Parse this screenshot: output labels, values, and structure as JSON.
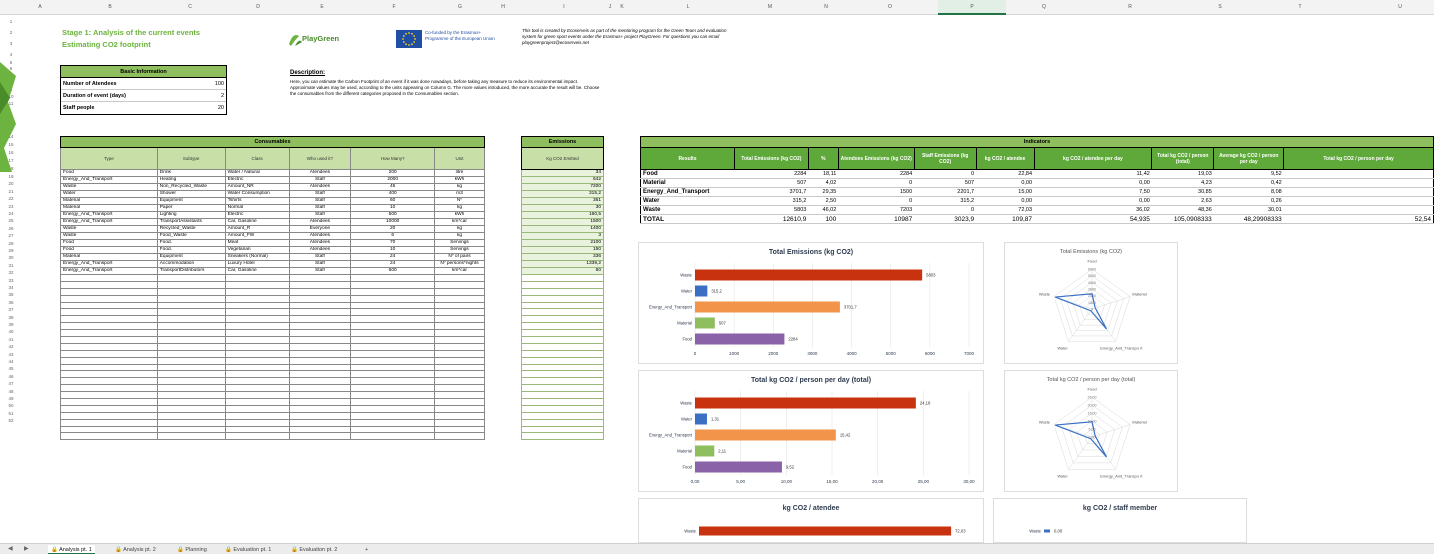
{
  "columns": [
    "A",
    "B",
    "C",
    "D",
    "E",
    "F",
    "G",
    "H",
    "I",
    "J",
    "K",
    "L",
    "M",
    "N",
    "O",
    "P",
    "Q",
    "R",
    "S",
    "T",
    "U"
  ],
  "rows": [
    "1",
    "2",
    "3",
    "4",
    "5",
    "6",
    "7",
    "8",
    "9",
    "10",
    "11",
    "12",
    "13",
    "14",
    "15",
    "16",
    "17",
    "18",
    "19",
    "20",
    "21",
    "22",
    "23",
    "24",
    "25",
    "26",
    "27",
    "28",
    "29",
    "30",
    "31",
    "32",
    "33",
    "34",
    "35",
    "36",
    "37",
    "38",
    "39",
    "40",
    "41",
    "42",
    "43",
    "44",
    "45",
    "46",
    "47",
    "48",
    "49",
    "50",
    "51",
    "52"
  ],
  "header": {
    "title_line1": "Stage 1: Analysis of the current events",
    "title_line2": "Estimating CO2 footprint",
    "playgreen": "PlayGreen",
    "eu_text": "Co-funded by the Erasmus+ Programme of the European Union",
    "note": "This tool is created by Ecoserveis as part of the mentoring program for the Green Team and evaluation system for green sport events under the Erasmus+ project PlayGreen. For questions you can email playgreenproject@ecoserveis.net"
  },
  "description": {
    "heading": "Description:",
    "text": "Here, you can estimate the Carbon Footprint of an event if it was done nowadays, before taking any measure to reduce its environmental impact. Approximate values may be used, according to the units appearing on Column G. The more values introduced, the more accurate the result will be. Choose the consumables from the different categories proposed in the Consumables section."
  },
  "basic_info": {
    "title": "Basic Information",
    "rows": [
      {
        "label": "Number of Atendees",
        "value": "100"
      },
      {
        "label": "Duration of event (days)",
        "value": "2"
      },
      {
        "label": "Staff people",
        "value": "20"
      }
    ]
  },
  "consumables": {
    "title": "Consumables",
    "headers": [
      "Type",
      "Subtype",
      "Class",
      "Who used it?",
      "How Many?",
      "Unit"
    ],
    "rows": [
      [
        "Food",
        "Drink",
        "Water / Natural",
        "Atendees",
        "200",
        "litre"
      ],
      [
        "Energy_And_Transport",
        "Heating",
        "Electric",
        "Staff",
        "2000",
        "kWh"
      ],
      [
        "Waste",
        "Non_Recycled_Waste",
        "Amount_NR",
        "Atendees",
        "45",
        "kg"
      ],
      [
        "Water",
        "Shower",
        "Water Consumption",
        "Staff",
        "400",
        "m3"
      ],
      [
        "Material",
        "Equipment",
        "Tshirts",
        "Staff",
        "60",
        "Nº"
      ],
      [
        "Material",
        "Paper",
        "Normal",
        "Staff",
        "10",
        "kg"
      ],
      [
        "Energy_And_Transport",
        "Lighting",
        "Electric",
        "Staff",
        "500",
        "kWh"
      ],
      [
        "Energy_And_Transport",
        "TransportAssistants",
        "Car, Gasoline",
        "Atendees",
        "10000",
        "km*car"
      ],
      [
        "Waste",
        "Recycled_Waste",
        "Amount_R",
        "Everyone",
        "20",
        "kg"
      ],
      [
        "Waste",
        "Food_Waste",
        "Amount_FW",
        "Atendees",
        "6",
        "kg"
      ],
      [
        "Food",
        "Food.",
        "Meat",
        "Atendees",
        "70",
        "Servings"
      ],
      [
        "Food",
        "Food.",
        "Vegetarian",
        "Atendees",
        "10",
        "Servings"
      ],
      [
        "Material",
        "Equipment",
        "Sneakers (Normal)",
        "Staff",
        "24",
        "Nº of pairs"
      ],
      [
        "Energy_And_Transport",
        "Accommodation",
        "Luxury Hotel",
        "Staff",
        "24",
        "Nº persons*nights"
      ],
      [
        "Energy_And_Transport",
        "TransportDistributors",
        "Car, Gasoline",
        "Staff",
        "600",
        "km*car"
      ]
    ],
    "empty_rows": 24
  },
  "emissions": {
    "title": "Emissions",
    "header": "Kg CO2 Emitted",
    "values": [
      "34",
      "642",
      "7200",
      "315,2",
      "361",
      "30",
      "160,5",
      "1500",
      "1400",
      "3",
      "2100",
      "150",
      "336",
      "1339,2",
      "60"
    ]
  },
  "indicators": {
    "title": "Indicators",
    "headers": [
      "Results",
      "Total Emissions (kg CO2)",
      "%",
      "Atendees Emissions (kg CO2)",
      "Staff Emissions (kg CO2)",
      "kg CO2 / atendee",
      "kg CO2 / atendee per day",
      "Total kg CO2 / person (total)",
      "Average kg CO2 / person per day",
      "Total kg CO2 / person per day"
    ],
    "rows": [
      [
        "Food",
        "2284",
        "18,11",
        "2284",
        "0",
        "22,84",
        "11,42",
        "19,03",
        "9,52",
        ""
      ],
      [
        "Material",
        "507",
        "4,02",
        "0",
        "507",
        "0,00",
        "0,00",
        "4,23",
        "0,42",
        ""
      ],
      [
        "Energy_And_Transport",
        "3701,7",
        "29,35",
        "1500",
        "2201,7",
        "15,00",
        "7,50",
        "30,85",
        "8,08",
        ""
      ],
      [
        "Water",
        "315,2",
        "2,50",
        "0",
        "315,2",
        "0,00",
        "0,00",
        "2,63",
        "0,26",
        ""
      ],
      [
        "Waste",
        "5803",
        "46,02",
        "7203",
        "0",
        "72,03",
        "36,02",
        "48,36",
        "30,01",
        ""
      ]
    ],
    "total": [
      "TOTAL",
      "12610,9",
      "100",
      "10987",
      "3023,9",
      "109,87",
      "54,935",
      "105,0908333",
      "48,29908333",
      "52,54"
    ]
  },
  "chart_data": [
    {
      "type": "bar",
      "title": "Total Emissions (kg CO2)",
      "categories": [
        "Waste",
        "Water",
        "Energy_And_Transport",
        "Material",
        "Food"
      ],
      "values": [
        5803,
        315.2,
        3701.7,
        507,
        2284
      ],
      "value_labels": [
        "5803",
        "315,2",
        "3701,7",
        "507",
        "2284"
      ],
      "colors": [
        "#c9320e",
        "#3a6fc4",
        "#f2944a",
        "#8fbe5e",
        "#8a62a8"
      ],
      "xlim": [
        0,
        7000
      ],
      "ticks": [
        "0",
        "1000",
        "2000",
        "3000",
        "4000",
        "5000",
        "6000",
        "7000"
      ],
      "grid": true
    },
    {
      "type": "radar",
      "title": "Total Emissions (kg CO2)",
      "categories": [
        "Food",
        "Material",
        "Energy_And_Transpo rt",
        "Water",
        "Waste"
      ],
      "values": [
        2284,
        507,
        3701.7,
        315.2,
        5803
      ],
      "rmax": 6000,
      "ticks": [
        "6000",
        "5000",
        "4000",
        "3000",
        "2000",
        "1000",
        "0"
      ]
    },
    {
      "type": "bar",
      "title": "Total kg CO2 / person per day (total)",
      "categories": [
        "Waste",
        "Water",
        "Energy_And_Transport",
        "Material",
        "Food"
      ],
      "values": [
        24.18,
        1.31,
        15.42,
        2.11,
        9.52
      ],
      "value_labels": [
        "24,18",
        "1,31",
        "15,42",
        "2,11",
        "9,52"
      ],
      "colors": [
        "#c9320e",
        "#3a6fc4",
        "#f2944a",
        "#8fbe5e",
        "#8a62a8"
      ],
      "xlim": [
        0,
        30
      ],
      "ticks": [
        "0,00",
        "5,00",
        "10,00",
        "15,00",
        "20,00",
        "25,00",
        "30,00"
      ],
      "grid": true
    },
    {
      "type": "radar",
      "title": "Total kg CO2 / person per day (total)",
      "categories": [
        "Food",
        "Material",
        "Energy_And_Transpo rt",
        "Water",
        "Waste"
      ],
      "values": [
        9.52,
        2.11,
        15.42,
        1.31,
        24.18
      ],
      "rmax": 25,
      "ticks": [
        "25,00",
        "20,00",
        "15,00",
        "10,00",
        "5,00",
        "0,00"
      ]
    },
    {
      "type": "bar",
      "title": "kg CO2 / atendee",
      "categories": [
        "Waste"
      ],
      "values": [
        72.03
      ],
      "value_labels": [
        "72,03"
      ],
      "colors": [
        "#c9320e"
      ],
      "xlim": [
        0,
        80
      ]
    },
    {
      "type": "bar",
      "title": "kg CO2 / staff member",
      "categories": [
        "Waste"
      ],
      "values": [
        0
      ],
      "value_labels": [
        "0,00"
      ],
      "colors": [
        "#3a6fc4"
      ],
      "xlim": [
        0,
        80
      ]
    }
  ],
  "sheet_tabs": [
    {
      "label": "Analysis pt. 1",
      "active": true
    },
    {
      "label": "Analysis pt. 2",
      "active": false
    },
    {
      "label": "Planning",
      "active": false
    },
    {
      "label": "Evaluation pt. 1",
      "active": false
    },
    {
      "label": "Evaluation pt. 2",
      "active": false
    }
  ],
  "add_sheet": "+",
  "colors": {
    "accent_green": "#6db33f",
    "header_green": "#8fbe5e",
    "excel_green": "#217346"
  }
}
